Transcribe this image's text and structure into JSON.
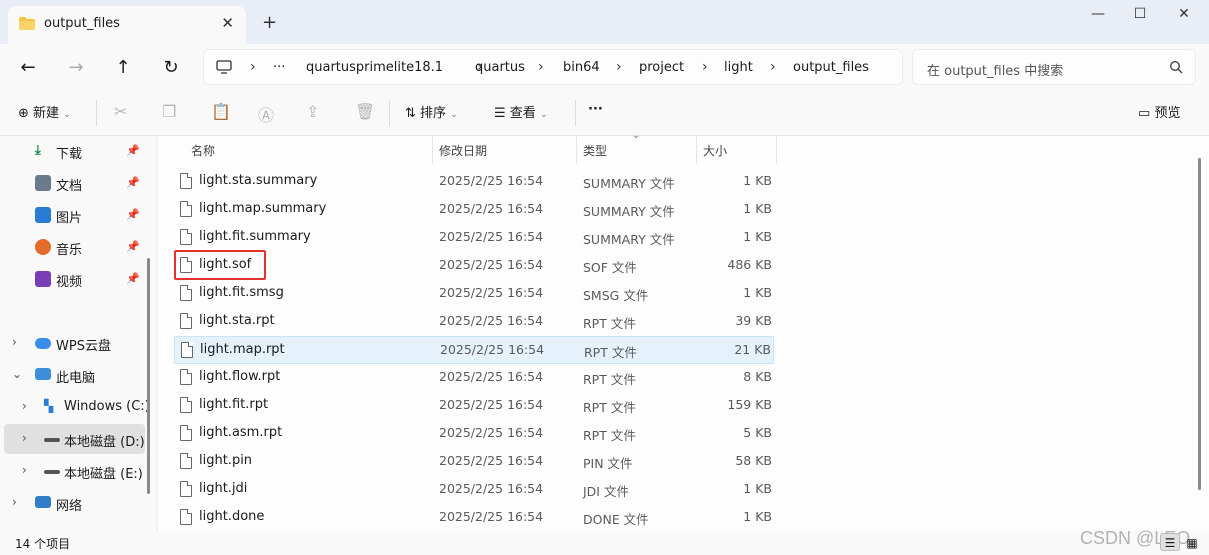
{
  "window": {
    "tab_title": "output_files",
    "tab_close": "✕",
    "new_tab": "+",
    "minimize": "—",
    "maximize": "☐",
    "close": "✕"
  },
  "nav": {
    "back": "←",
    "forward": "→",
    "up": "↑",
    "refresh": "↻"
  },
  "breadcrumb": {
    "more": "···",
    "items": [
      "quartusprimelite18.1",
      "quartus",
      "bin64",
      "project",
      "light",
      "output_files"
    ]
  },
  "search": {
    "placeholder": "在 output_files 中搜索"
  },
  "toolbar": {
    "new_label": "新建",
    "sort_label": "排序",
    "view_label": "查看",
    "more": "···",
    "preview_label": "预览"
  },
  "sidebar": {
    "quick": [
      {
        "label": "下载",
        "icon": "download-icon",
        "color": "#1f8a4c"
      },
      {
        "label": "文档",
        "icon": "documents-icon",
        "color": "#6b7b8c"
      },
      {
        "label": "图片",
        "icon": "pictures-icon",
        "color": "#2a7bd6"
      },
      {
        "label": "音乐",
        "icon": "music-icon",
        "color": "#e36b2c"
      },
      {
        "label": "视频",
        "icon": "videos-icon",
        "color": "#7a3db8"
      }
    ],
    "wps": "WPS云盘",
    "thispc": "此电脑",
    "drives": [
      "Windows (C:)",
      "本地磁盘 (D:)",
      "本地磁盘 (E:)"
    ],
    "network": "网络"
  },
  "columns": {
    "name": "名称",
    "date": "修改日期",
    "type": "类型",
    "size": "大小"
  },
  "files": [
    {
      "name": "light.sta.summary",
      "date": "2025/2/25 16:54",
      "type": "SUMMARY 文件",
      "size": "1 KB"
    },
    {
      "name": "light.map.summary",
      "date": "2025/2/25 16:54",
      "type": "SUMMARY 文件",
      "size": "1 KB"
    },
    {
      "name": "light.fit.summary",
      "date": "2025/2/25 16:54",
      "type": "SUMMARY 文件",
      "size": "1 KB"
    },
    {
      "name": "light.sof",
      "date": "2025/2/25 16:54",
      "type": "SOF 文件",
      "size": "486 KB"
    },
    {
      "name": "light.fit.smsg",
      "date": "2025/2/25 16:54",
      "type": "SMSG 文件",
      "size": "1 KB"
    },
    {
      "name": "light.sta.rpt",
      "date": "2025/2/25 16:54",
      "type": "RPT 文件",
      "size": "39 KB"
    },
    {
      "name": "light.map.rpt",
      "date": "2025/2/25 16:54",
      "type": "RPT 文件",
      "size": "21 KB"
    },
    {
      "name": "light.flow.rpt",
      "date": "2025/2/25 16:54",
      "type": "RPT 文件",
      "size": "8 KB"
    },
    {
      "name": "light.fit.rpt",
      "date": "2025/2/25 16:54",
      "type": "RPT 文件",
      "size": "159 KB"
    },
    {
      "name": "light.asm.rpt",
      "date": "2025/2/25 16:54",
      "type": "RPT 文件",
      "size": "5 KB"
    },
    {
      "name": "light.pin",
      "date": "2025/2/25 16:54",
      "type": "PIN 文件",
      "size": "58 KB"
    },
    {
      "name": "light.jdi",
      "date": "2025/2/25 16:54",
      "type": "JDI 文件",
      "size": "1 KB"
    },
    {
      "name": "light.done",
      "date": "2025/2/25 16:54",
      "type": "DONE 文件",
      "size": "1 KB"
    }
  ],
  "status": {
    "count": "14 个项目"
  },
  "watermark": "CSDN @LEO"
}
